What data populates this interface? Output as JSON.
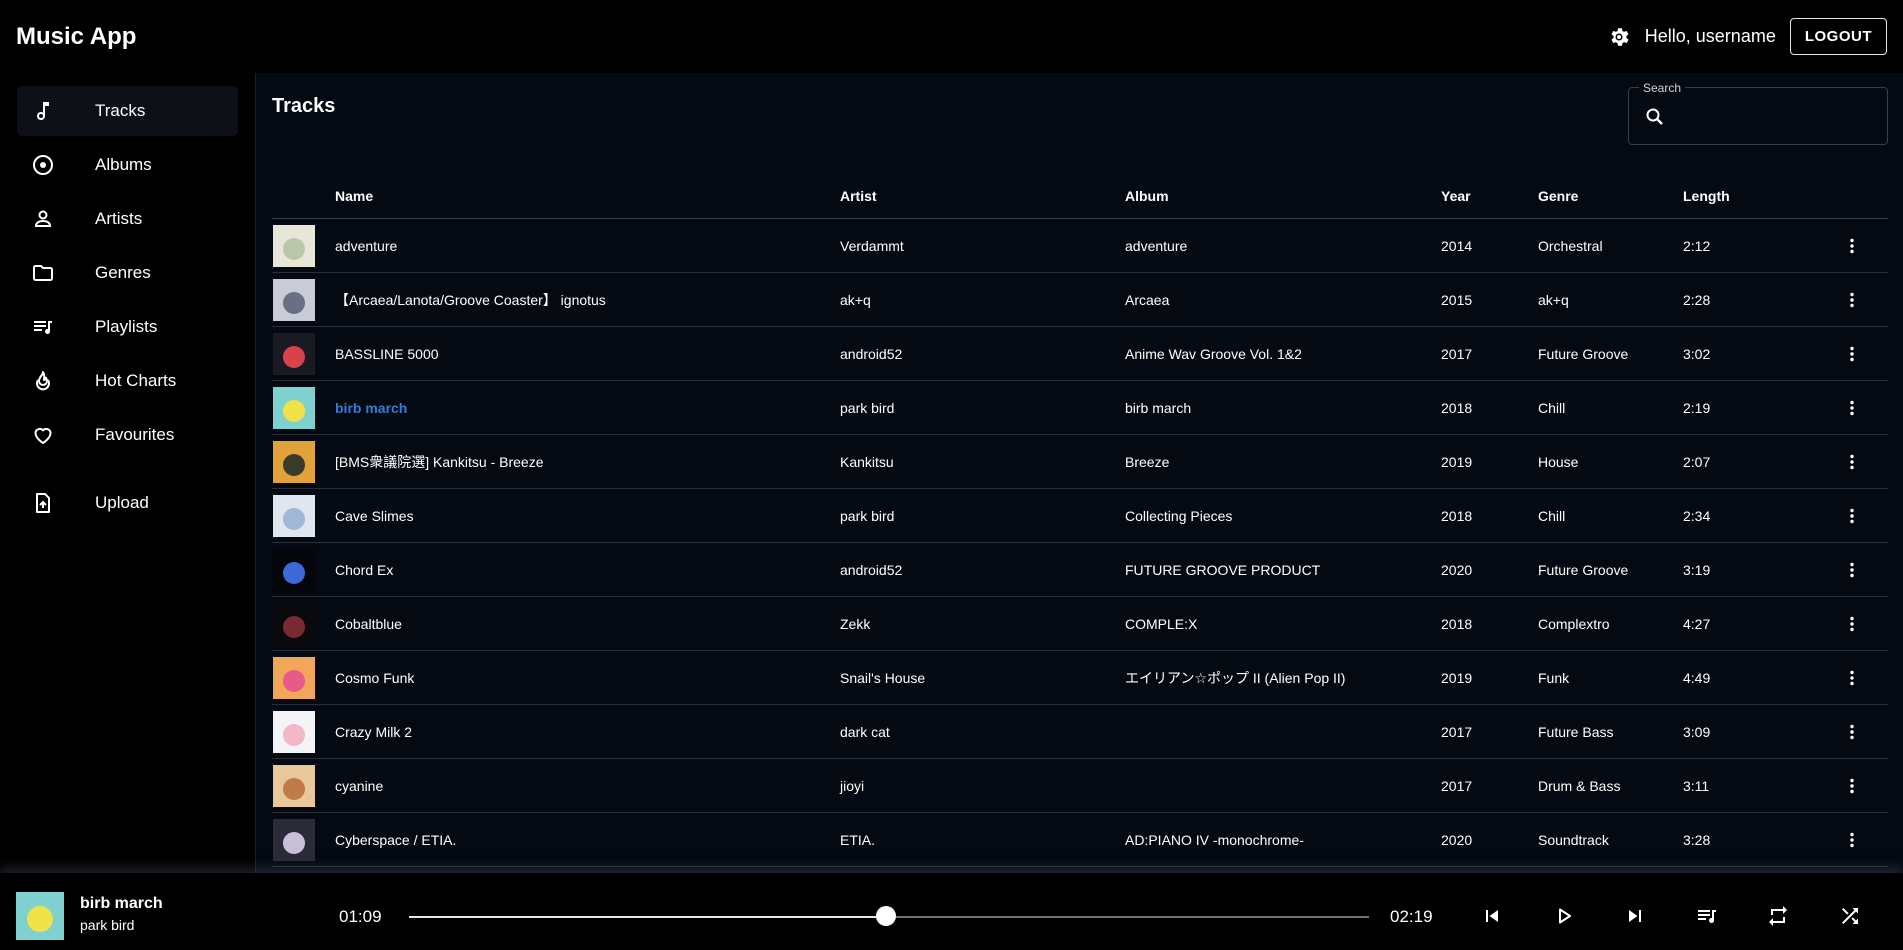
{
  "app": {
    "title": "Music App"
  },
  "header": {
    "greeting": "Hello, username",
    "logout_label": "LOGOUT"
  },
  "sidebar": {
    "items": [
      {
        "label": "Tracks",
        "icon": "music-note-icon",
        "active": true
      },
      {
        "label": "Albums",
        "icon": "album-icon"
      },
      {
        "label": "Artists",
        "icon": "person-icon"
      },
      {
        "label": "Genres",
        "icon": "folder-icon"
      },
      {
        "label": "Playlists",
        "icon": "playlist-icon"
      },
      {
        "label": "Hot Charts",
        "icon": "fire-icon"
      },
      {
        "label": "Favourites",
        "icon": "heart-icon"
      },
      {
        "label": "Upload",
        "icon": "upload-file-icon"
      }
    ]
  },
  "main": {
    "title": "Tracks",
    "search": {
      "label": "Search",
      "value": ""
    },
    "columns": {
      "name": "Name",
      "artist": "Artist",
      "album": "Album",
      "year": "Year",
      "genre": "Genre",
      "length": "Length"
    },
    "accent": "#2f7fd8",
    "rows": [
      {
        "name": "adventure",
        "artist": "Verdammt",
        "album": "adventure",
        "year": "2014",
        "genre": "Orchestral",
        "length": "2:12",
        "art": [
          "#e8e6d8",
          "#b9c8a8"
        ]
      },
      {
        "name": "【Arcaea/Lanota/Groove Coaster】 ignotus",
        "artist": "ak+q",
        "album": "Arcaea",
        "year": "2015",
        "genre": "ak+q",
        "length": "2:28",
        "art": [
          "#c9cbd6",
          "#6a6f86"
        ]
      },
      {
        "name": "BASSLINE 5000",
        "artist": "android52",
        "album": "Anime Wav Groove Vol. 1&2",
        "year": "2017",
        "genre": "Future Groove",
        "length": "3:02",
        "art": [
          "#1a1a22",
          "#d8424a"
        ]
      },
      {
        "name": "birb march",
        "artist": "park bird",
        "album": "birb march",
        "year": "2018",
        "genre": "Chill",
        "length": "2:19",
        "art": [
          "#7fd1d0",
          "#f2e24a"
        ],
        "active": true
      },
      {
        "name": "[BMS衆議院選] Kankitsu - Breeze",
        "artist": "Kankitsu",
        "album": "Breeze",
        "year": "2019",
        "genre": "House",
        "length": "2:07",
        "art": [
          "#e2a23a",
          "#3a3a2a"
        ]
      },
      {
        "name": "Cave Slimes",
        "artist": "park bird",
        "album": "Collecting Pieces",
        "year": "2018",
        "genre": "Chill",
        "length": "2:34",
        "art": [
          "#dfe6f0",
          "#9fb8d8"
        ]
      },
      {
        "name": "Chord Ex",
        "artist": "android52",
        "album": "FUTURE GROOVE PRODUCT",
        "year": "2020",
        "genre": "Future Groove",
        "length": "3:19",
        "art": [
          "#05060a",
          "#3b6ad8"
        ]
      },
      {
        "name": "Cobaltblue",
        "artist": "Zekk",
        "album": "COMPLE:X",
        "year": "2018",
        "genre": "Complextro",
        "length": "4:27",
        "art": [
          "#0a0a0e",
          "#7a2a30"
        ]
      },
      {
        "name": "Cosmo Funk",
        "artist": "Snail's House",
        "album": "エイリアン☆ポップ II (Alien Pop II)",
        "year": "2019",
        "genre": "Funk",
        "length": "4:49",
        "art": [
          "#f2a65a",
          "#e85a8a"
        ]
      },
      {
        "name": "Crazy Milk 2",
        "artist": "dark cat",
        "album": "",
        "year": "2017",
        "genre": "Future Bass",
        "length": "3:09",
        "art": [
          "#f4f4f6",
          "#f2b8c8"
        ]
      },
      {
        "name": "cyanine",
        "artist": "jioyi",
        "album": "",
        "year": "2017",
        "genre": "Drum & Bass",
        "length": "3:11",
        "art": [
          "#e8c89a",
          "#c27a4a"
        ]
      },
      {
        "name": "Cyberspace / ETIA.",
        "artist": "ETIA.",
        "album": "AD:PIANO IV -monochrome-",
        "year": "2020",
        "genre": "Soundtrack",
        "length": "3:28",
        "art": [
          "#2a2a38",
          "#c8c0d8"
        ]
      }
    ]
  },
  "player": {
    "title": "birb march",
    "artist": "park bird",
    "current_time": "01:09",
    "total_time": "02:19",
    "progress": 0.4964,
    "art": [
      "#7fd1d0",
      "#f2e24a"
    ]
  }
}
